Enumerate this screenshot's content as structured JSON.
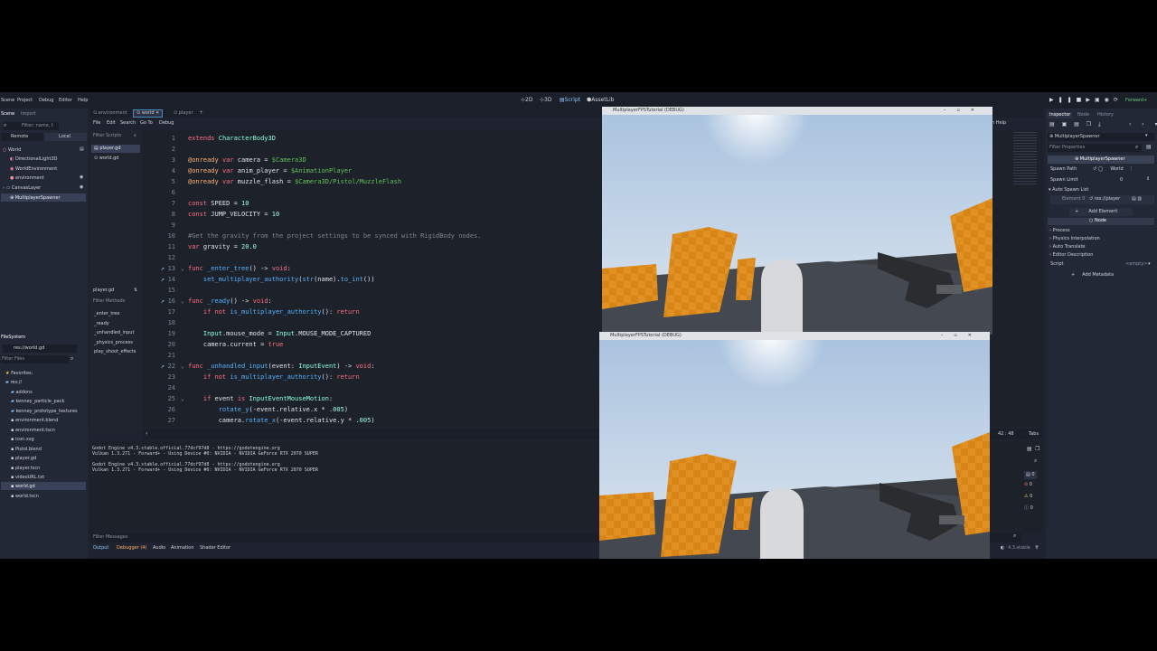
{
  "topbar": {
    "menus": [
      "Scene",
      "Project",
      "Debug",
      "Editor",
      "Help"
    ],
    "workspaces": [
      "2D",
      "3D",
      "Script",
      "AssetLib"
    ],
    "renderer": "Forward+"
  },
  "scene_dock": {
    "tabs": [
      "Scene",
      "Import"
    ],
    "filter_placeholder": "Filter: name, t",
    "mode_tabs": [
      "Remote",
      "Local"
    ],
    "nodes": [
      "World",
      "DirectionalLight3D",
      "WorldEnvironment",
      "environment",
      "CanvasLayer",
      "MultiplayerSpawner"
    ]
  },
  "filesystem": {
    "title": "FileSystem",
    "path": "res://world.gd",
    "filter_placeholder": "Filter Files",
    "items": [
      "Favorites:",
      "res://",
      "addons",
      "kenney_particle_pack",
      "kenney_prototype_textures",
      "environment.blend",
      "environment.tscn",
      "icon.svg",
      "Pistol.blend",
      "player.gd",
      "player.tscn",
      "videoURL.txt",
      "world.gd",
      "world.tscn"
    ]
  },
  "script_editor": {
    "scene_tabs": [
      "environment",
      "world",
      "player"
    ],
    "menus": [
      "File",
      "Edit",
      "Search",
      "Go To",
      "Debug"
    ],
    "online_help": "h Help",
    "filter_scripts": "Filter Scripts",
    "scripts": [
      "player.gd",
      "world.gd"
    ],
    "current_script": "player.gd",
    "filter_methods": "Filter Methods",
    "methods": [
      "_enter_tree",
      "_ready",
      "_unhandled_input",
      "_physics_process",
      "play_shoot_effects"
    ],
    "status_line": "42 :  48",
    "status_tabs": "Tabs"
  },
  "code_lines": [
    {
      "n": "1",
      "html": "<span class=\"kw\">extends</span> <span class=\"ty\">CharacterBody3D</span>"
    },
    {
      "n": "2",
      "html": ""
    },
    {
      "n": "3",
      "html": "<span class=\"an\">@onready</span> <span class=\"kw\">var</span> camera = <span class=\"np\">$Camera3D</span>"
    },
    {
      "n": "4",
      "html": "<span class=\"an\">@onready</span> <span class=\"kw\">var</span> anim_player = <span class=\"np\">$AnimationPlayer</span>"
    },
    {
      "n": "5",
      "html": "<span class=\"an\">@onready</span> <span class=\"kw\">var</span> muzzle_flash = <span class=\"np\">$Camera3D/Pistol/MuzzleFlash</span>"
    },
    {
      "n": "6",
      "html": ""
    },
    {
      "n": "7",
      "html": "<span class=\"kw\">const</span> SPEED = <span class=\"nm\">10</span>"
    },
    {
      "n": "8",
      "html": "<span class=\"kw\">const</span> JUMP_VELOCITY = <span class=\"nm\">10</span>"
    },
    {
      "n": "9",
      "html": ""
    },
    {
      "n": "10",
      "html": "<span class=\"cm\">#Get the gravity from the project settings to be synced with RigidBody nodes.</span>"
    },
    {
      "n": "11",
      "html": "<span class=\"kw\">var</span> gravity = <span class=\"nm\">20.0</span>"
    },
    {
      "n": "12",
      "html": ""
    },
    {
      "n": "13",
      "html": "<span class=\"kw\">func</span> <span class=\"fn\">_enter_tree</span>() -> <span class=\"kw\">void</span>:"
    },
    {
      "n": "14",
      "html": "    <span class=\"fn\">set_multiplayer_authority</span>(<span class=\"fn\">str</span>(name).<span class=\"fn\">to_int</span>())"
    },
    {
      "n": "15",
      "html": ""
    },
    {
      "n": "16",
      "html": "<span class=\"kw\">func</span> <span class=\"fn\">_ready</span>() -> <span class=\"kw\">void</span>:"
    },
    {
      "n": "17",
      "html": "    <span class=\"kw\">if not</span> <span class=\"fn\">is_multiplayer_authority</span>(): <span class=\"kw\">return</span>"
    },
    {
      "n": "18",
      "html": ""
    },
    {
      "n": "19",
      "html": "    <span class=\"ty\">Input</span>.mouse_mode = <span class=\"ty\">Input</span>.MOUSE_MODE_CAPTURED"
    },
    {
      "n": "20",
      "html": "    camera.current = <span class=\"kw\">true</span>"
    },
    {
      "n": "21",
      "html": ""
    },
    {
      "n": "22",
      "html": "<span class=\"kw\">func</span> <span class=\"fn\">_unhandled_input</span>(event: <span class=\"ty\">InputEvent</span>) -> <span class=\"kw\">void</span>:"
    },
    {
      "n": "23",
      "html": "    <span class=\"kw\">if not</span> <span class=\"fn\">is_multiplayer_authority</span>(): <span class=\"kw\">return</span>"
    },
    {
      "n": "24",
      "html": ""
    },
    {
      "n": "25",
      "html": "    <span class=\"kw\">if</span> event <span class=\"kw\">is</span> <span class=\"ty\">InputEventMouseMotion</span>:"
    },
    {
      "n": "26",
      "html": "        <span class=\"fn\">rotate_y</span>(-event.relative.x * <span class=\"nm\">.005</span>)"
    },
    {
      "n": "27",
      "html": "        camera.<span class=\"fn\">rotate_x</span>(-event.relative.y * <span class=\"nm\">.005</span>)"
    }
  ],
  "output": {
    "lines": [
      "Godot Engine v4.3.stable.official.77dcf97d8 - https://godotengine.org",
      "Vulkan 1.3.271 - Forward+ - Using Device #0: NVIDIA - NVIDIA GeForce RTX 2070 SUPER",
      "",
      "Godot Engine v4.3.stable.official.77dcf97d8 - https://godotengine.org",
      "Vulkan 1.3.271 - Forward+ - Using Device #0: NVIDIA - NVIDIA GeForce RTX 2070 SUPER"
    ],
    "filter_placeholder": "Filter Messages",
    "counters": [
      "0",
      "0",
      "0",
      "0"
    ]
  },
  "bottom_tabs": [
    "Output",
    "Debugger (4)",
    "Audio",
    "Animation",
    "Shader Editor"
  ],
  "version": "4.3.stable",
  "inspector": {
    "tabs": [
      "Inspector",
      "Node",
      "History"
    ],
    "node_path": "MultiplayerSpawner",
    "filter_placeholder": "Filter Properties",
    "header": "MultiplayerSpawner",
    "spawn_path_label": "Spawn Path",
    "spawn_path_value": "World",
    "spawn_limit_label": "Spawn Limit",
    "spawn_limit_value": "0",
    "auto_spawn_list": "Auto Spawn List",
    "element_label": "Element 0",
    "element_value": "res://player",
    "add_element": "Add Element",
    "node_section": "Node",
    "sections": [
      "Process",
      "Physics Interpolation",
      "Auto Translate",
      "Editor Description"
    ],
    "script_label": "Script",
    "script_value": "<empty>",
    "add_metadata": "Add Metadata"
  },
  "game_windows": [
    {
      "title": "MultiplayerFPSTutorial (DEBUG)"
    },
    {
      "title": "MultiplayerFPSTutorial (DEBUG)"
    }
  ],
  "colors": {
    "editor_bg": "#1f2330",
    "panel_bg": "#232837",
    "accent": "#478cbf",
    "box_orange": "#d9861c",
    "sky": "#c3d3e6"
  }
}
